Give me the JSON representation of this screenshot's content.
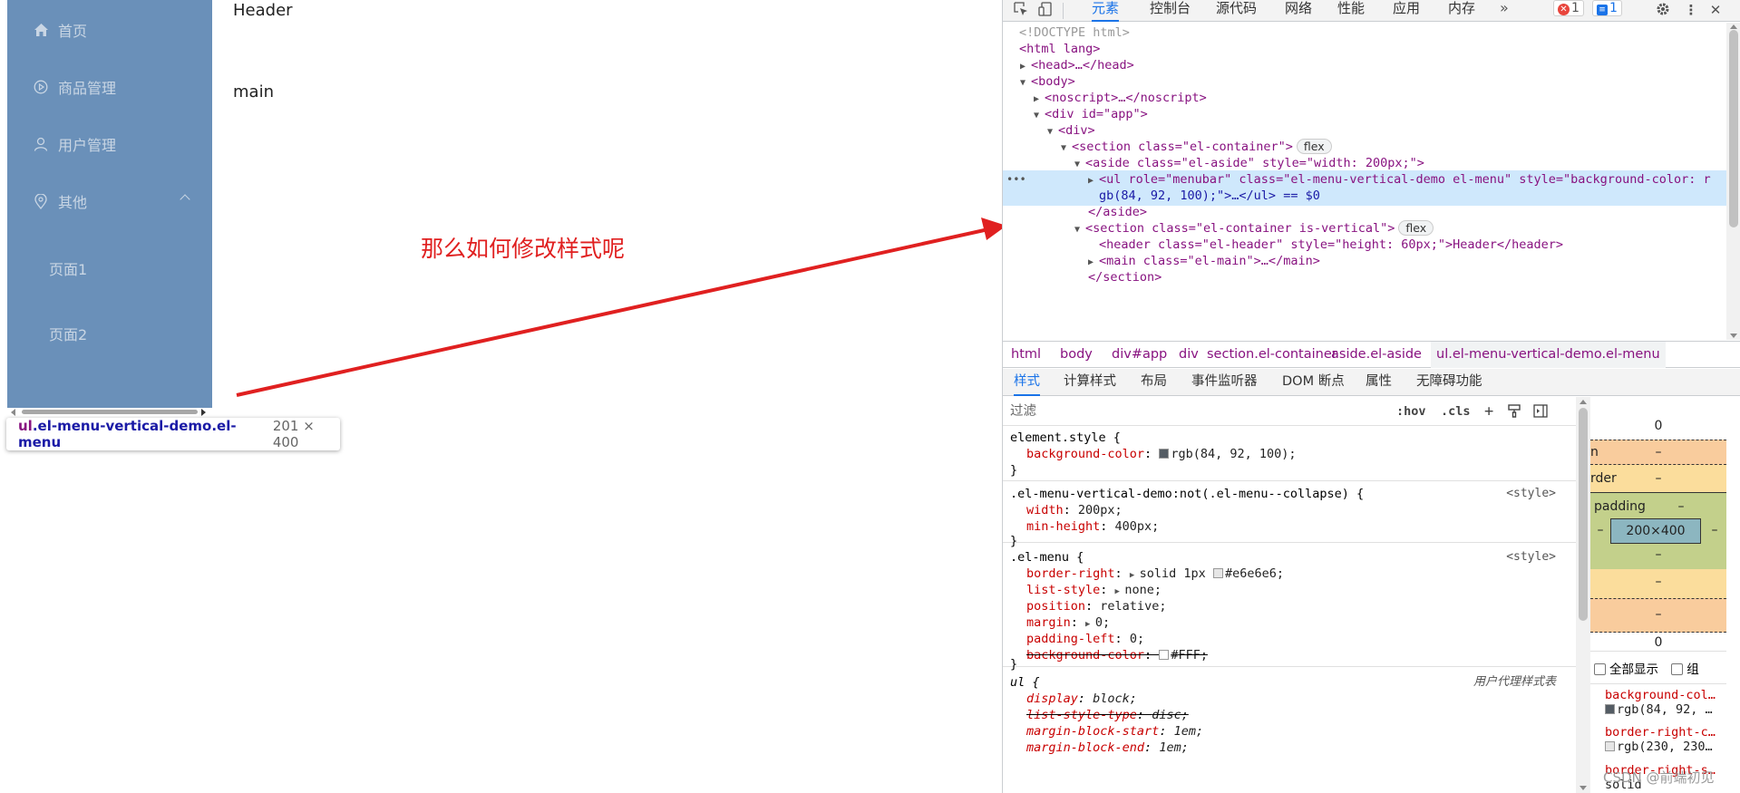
{
  "page": {
    "header_text": "Header",
    "main_text": "main",
    "annotation": "那么如何修改样式呢",
    "colors": {
      "aside_bg": "#6a90b9",
      "menu_text": "#c9d6e4",
      "annotation": "#e02020"
    },
    "menu": {
      "items": [
        {
          "label": "首页",
          "icon": "home-icon"
        },
        {
          "label": "商品管理",
          "icon": "circle-play-icon"
        },
        {
          "label": "用户管理",
          "icon": "user-icon"
        },
        {
          "label": "其他",
          "icon": "location-icon"
        }
      ],
      "submenu": [
        "页面1",
        "页面2"
      ]
    },
    "tooltip": {
      "selector_tag": "ul",
      "selector_class": ".el-menu-vertical-demo.el-menu",
      "size": "201 × 400"
    }
  },
  "devtools": {
    "tabs": [
      "元素",
      "控制台",
      "源代码",
      "网络",
      "性能",
      "应用",
      "内存"
    ],
    "more_tabs_icon": "chevron-double-right-icon",
    "error_count": "1",
    "message_count": "1",
    "dom_lines": [
      {
        "text": "<!DOCTYPE html>"
      },
      {
        "text": "<html lang>"
      },
      {
        "text": "<head>…</head>"
      },
      {
        "text": "<body>"
      },
      {
        "text": "<noscript>…</noscript>"
      },
      {
        "text": "<div id=\"app\">"
      },
      {
        "text": "<div>"
      },
      {
        "text": "<section class=\"el-container\">",
        "pill": "flex"
      },
      {
        "text": "<aside class=\"el-aside\" style=\"width: 200px;\">"
      },
      {
        "text": "<ul role=\"menubar\" class=\"el-menu-vertical-demo el-menu\" style=\"background-color: r"
      },
      {
        "text": "gb(84, 92, 100);\">…</ul> == $0"
      },
      {
        "text": "</aside>"
      },
      {
        "text": "<section class=\"el-container is-vertical\">",
        "pill": "flex"
      },
      {
        "text": "<header class=\"el-header\" style=\"height: 60px;\">Header</header>"
      },
      {
        "text": "<main class=\"el-main\">…</main>"
      },
      {
        "text": "</section>"
      }
    ],
    "breadcrumbs": [
      "html",
      "body",
      "div#app",
      "div",
      "section.el-container",
      "aside.el-aside",
      "ul.el-menu-vertical-demo.el-menu"
    ],
    "subtabs": [
      "样式",
      "计算样式",
      "布局",
      "事件监听器",
      "DOM 断点",
      "属性",
      "无障碍功能"
    ],
    "filter": {
      "placeholder": "过滤",
      "hov": ":hov",
      "cls": ".cls"
    },
    "rules": [
      {
        "selector": "element.style {",
        "source": "",
        "props": [
          {
            "name": "background-color",
            "value": "rgb(84, 92, 100);",
            "swatch": "#545c64"
          }
        ]
      },
      {
        "selector": ".el-menu-vertical-demo:not(.el-menu--collapse) {",
        "source": "<style>",
        "props": [
          {
            "name": "width",
            "value": "200px;"
          },
          {
            "name": "min-height",
            "value": "400px;"
          }
        ]
      },
      {
        "selector": ".el-menu {",
        "source": "<style>",
        "props": [
          {
            "name": "border-right",
            "value": "solid 1px #e6e6e6;",
            "swatch": "#e6e6e6",
            "expand": true
          },
          {
            "name": "list-style",
            "value": "none;",
            "expand": true
          },
          {
            "name": "position",
            "value": "relative;"
          },
          {
            "name": "margin",
            "value": "0;",
            "expand": true
          },
          {
            "name": "padding-left",
            "value": "0;"
          },
          {
            "name": "background-color",
            "value": "#FFF;",
            "swatch": "#ffffff",
            "strike": true
          }
        ]
      },
      {
        "selector": "ul {",
        "source": "用户代理样式表",
        "props": [
          {
            "name": "display",
            "value": "block;"
          },
          {
            "name": "list-style-type",
            "value": "disc;",
            "strike": true
          },
          {
            "name": "margin-block-start",
            "value": "1em;"
          },
          {
            "name": "margin-block-end",
            "value": "1em;"
          }
        ]
      }
    ],
    "box_model": {
      "margin_top": "0",
      "margin_label": "n",
      "border_label": "rder",
      "padding_label": "padding",
      "dash": "–",
      "content_size": "200×400",
      "margin_bottom": "0"
    },
    "computed": {
      "show_all": "全部显示",
      "group": "组",
      "items": [
        {
          "name": "background-col…",
          "value": "rgb(84, 92, …",
          "swatch": "#545c64"
        },
        {
          "name": "border-right-c…",
          "value": "rgb(230, 230…",
          "swatch": "#e6e6e6"
        },
        {
          "name": "border-right-s…",
          "value": "solid"
        }
      ]
    },
    "watermark": "CSDN @前端初见"
  }
}
